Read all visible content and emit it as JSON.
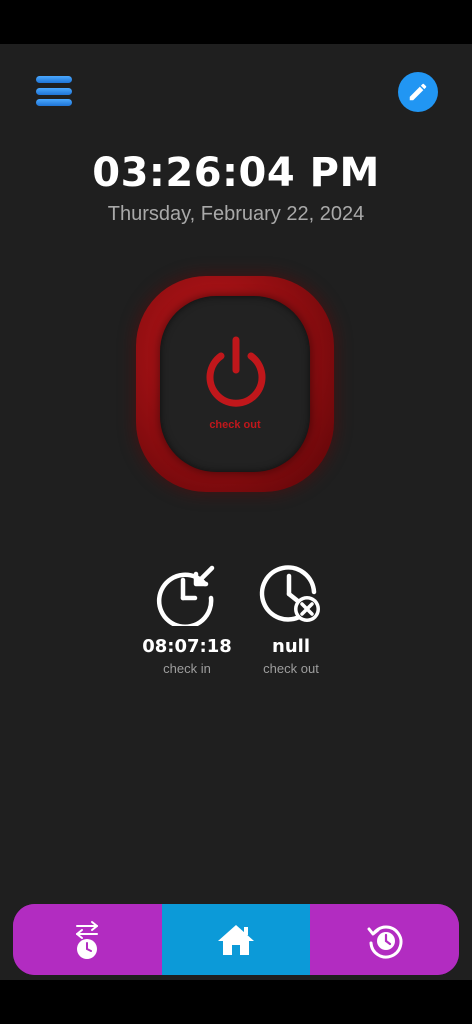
{
  "header": {
    "menu_icon": "hamburger-menu-icon",
    "edit_icon": "pencil-icon",
    "time": "03:26:04 PM",
    "date": "Thursday, February 22, 2024"
  },
  "power_button": {
    "icon": "power-icon",
    "label": "check out",
    "color": "#c0171b"
  },
  "stats": [
    {
      "icon": "clock-arrow-in-icon",
      "value": "08:07:18",
      "label": "check in"
    },
    {
      "icon": "clock-cancel-icon",
      "value": "null",
      "label": "check out"
    }
  ],
  "bottom_nav": {
    "tabs": [
      {
        "icon": "swap-clock-icon",
        "active": false
      },
      {
        "icon": "home-icon",
        "active": true
      },
      {
        "icon": "history-icon",
        "active": false
      }
    ],
    "colors": {
      "inactive": "#b22cc1",
      "active": "#0c9ad8"
    }
  },
  "colors": {
    "background": "#1f1f1f",
    "accent_blue": "#2196f3",
    "text_primary": "#ffffff",
    "text_secondary": "#a9a9a9"
  }
}
